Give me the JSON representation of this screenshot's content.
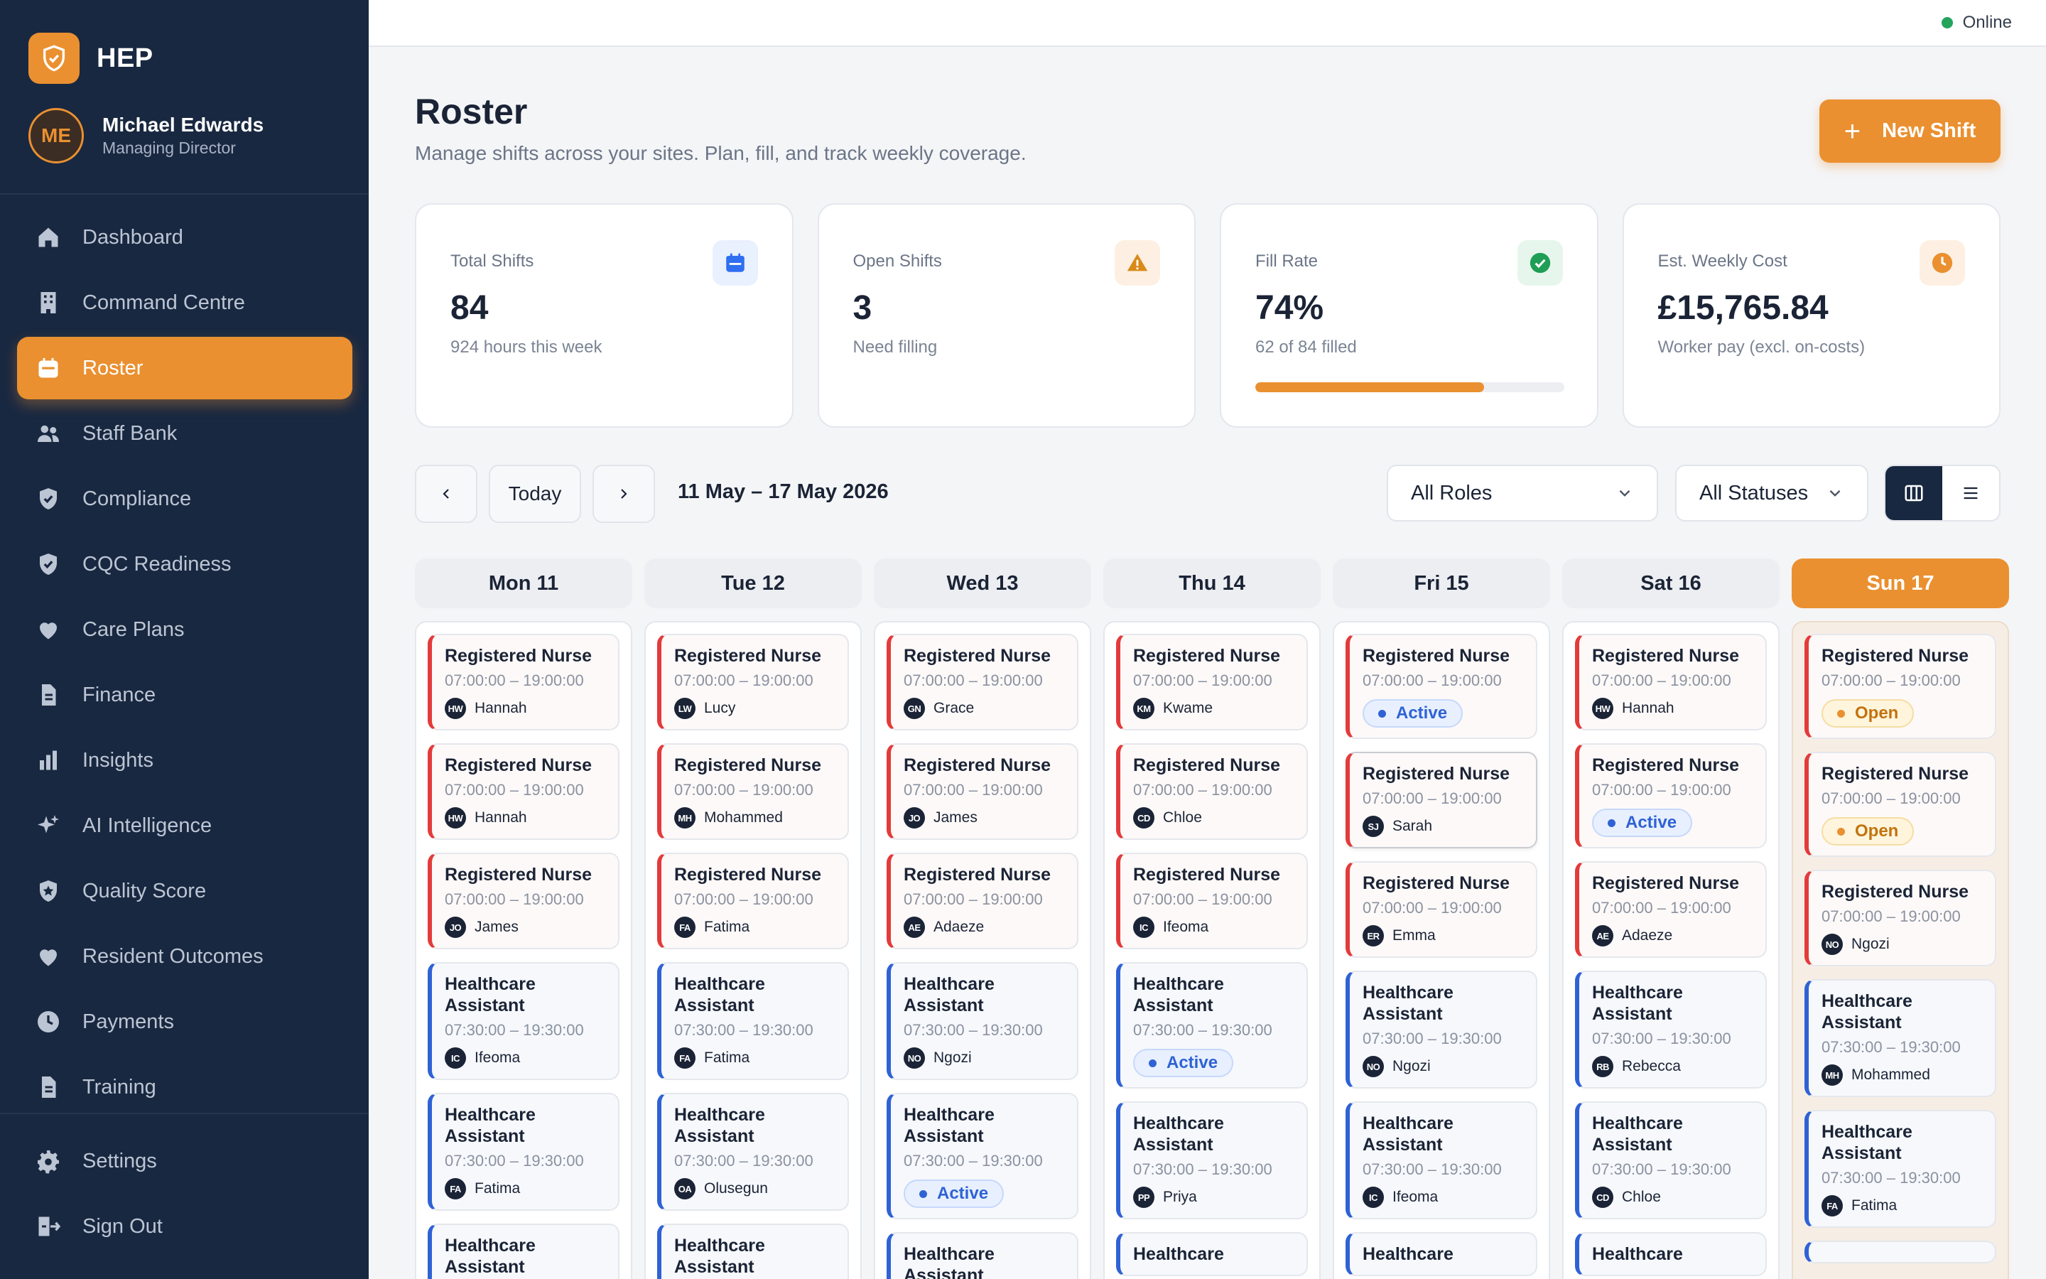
{
  "brand": {
    "name": "HEP"
  },
  "user": {
    "initials": "ME",
    "name": "Michael Edwards",
    "role": "Managing Director"
  },
  "nav": [
    {
      "label": "Dashboard",
      "icon": "home-icon"
    },
    {
      "label": "Command Centre",
      "icon": "building-icon"
    },
    {
      "label": "Roster",
      "icon": "calendar-icon",
      "active": true
    },
    {
      "label": "Staff Bank",
      "icon": "users-icon"
    },
    {
      "label": "Compliance",
      "icon": "shield-check-icon"
    },
    {
      "label": "CQC Readiness",
      "icon": "shield-check-icon"
    },
    {
      "label": "Care Plans",
      "icon": "heart-icon"
    },
    {
      "label": "Finance",
      "icon": "document-icon"
    },
    {
      "label": "Insights",
      "icon": "bar-chart-icon"
    },
    {
      "label": "AI Intelligence",
      "icon": "sparkles-icon"
    },
    {
      "label": "Quality Score",
      "icon": "shield-star-icon"
    },
    {
      "label": "Resident Outcomes",
      "icon": "heart-icon"
    },
    {
      "label": "Payments",
      "icon": "clock-icon"
    },
    {
      "label": "Training",
      "icon": "document-icon"
    }
  ],
  "nav_bottom": [
    {
      "label": "Settings",
      "icon": "gear-icon"
    },
    {
      "label": "Sign Out",
      "icon": "logout-icon"
    }
  ],
  "status": {
    "label": "Online",
    "color": "#22a45d"
  },
  "header": {
    "title": "Roster",
    "subtitle": "Manage shifts across your sites. Plan, fill, and track weekly coverage.",
    "new_shift_label": "New Shift"
  },
  "stats": [
    {
      "label": "Total Shifts",
      "value": "84",
      "sub": "924 hours this week",
      "icon": "calendar-icon"
    },
    {
      "label": "Open Shifts",
      "value": "3",
      "sub": "Need filling",
      "icon": "warning-icon"
    },
    {
      "label": "Fill Rate",
      "value": "74%",
      "sub": "62 of 84 filled",
      "icon": "check-circle-icon",
      "progress": 0.74
    },
    {
      "label": "Est. Weekly Cost",
      "value": "£15,765.84",
      "sub": "Worker pay (excl. on-costs)",
      "icon": "clock-icon"
    }
  ],
  "toolbar": {
    "today_label": "Today",
    "date_range": "11 May – 17 May 2026",
    "role_filter": "All Roles",
    "status_filter": "All Statuses"
  },
  "colors": {
    "accent": "#ea9030",
    "navy": "#192841",
    "registered_nurse": "#e33b3b",
    "healthcare_assistant": "#2f62d4"
  },
  "days": [
    {
      "label": "Mon 11",
      "today": false,
      "shifts": [
        {
          "type": "rn",
          "role": "Registered Nurse",
          "time": "07:00:00 – 19:00:00",
          "initials": "HW",
          "worker": "Hannah"
        },
        {
          "type": "rn",
          "role": "Registered Nurse",
          "time": "07:00:00 – 19:00:00",
          "initials": "HW",
          "worker": "Hannah"
        },
        {
          "type": "rn",
          "role": "Registered Nurse",
          "time": "07:00:00 – 19:00:00",
          "initials": "JO",
          "worker": "James"
        },
        {
          "type": "ha",
          "role": "Healthcare Assistant",
          "time": "07:30:00 – 19:30:00",
          "initials": "IC",
          "worker": "Ifeoma"
        },
        {
          "type": "ha",
          "role": "Healthcare Assistant",
          "time": "07:30:00 – 19:30:00",
          "initials": "FA",
          "worker": "Fatima"
        },
        {
          "type": "ha",
          "role": "Healthcare Assistant",
          "time": "",
          "initials": "",
          "worker": ""
        }
      ]
    },
    {
      "label": "Tue 12",
      "today": false,
      "shifts": [
        {
          "type": "rn",
          "role": "Registered Nurse",
          "time": "07:00:00 – 19:00:00",
          "initials": "LW",
          "worker": "Lucy"
        },
        {
          "type": "rn",
          "role": "Registered Nurse",
          "time": "07:00:00 – 19:00:00",
          "initials": "MH",
          "worker": "Mohammed"
        },
        {
          "type": "rn",
          "role": "Registered Nurse",
          "time": "07:00:00 – 19:00:00",
          "initials": "FA",
          "worker": "Fatima"
        },
        {
          "type": "ha",
          "role": "Healthcare Assistant",
          "time": "07:30:00 – 19:30:00",
          "initials": "FA",
          "worker": "Fatima"
        },
        {
          "type": "ha",
          "role": "Healthcare Assistant",
          "time": "07:30:00 – 19:30:00",
          "initials": "OA",
          "worker": "Olusegun"
        },
        {
          "type": "ha",
          "role": "Healthcare Assistant",
          "time": "",
          "initials": "",
          "worker": ""
        }
      ]
    },
    {
      "label": "Wed 13",
      "today": false,
      "shifts": [
        {
          "type": "rn",
          "role": "Registered Nurse",
          "time": "07:00:00 – 19:00:00",
          "initials": "GN",
          "worker": "Grace"
        },
        {
          "type": "rn",
          "role": "Registered Nurse",
          "time": "07:00:00 – 19:00:00",
          "initials": "JO",
          "worker": "James"
        },
        {
          "type": "rn",
          "role": "Registered Nurse",
          "time": "07:00:00 – 19:00:00",
          "initials": "AE",
          "worker": "Adaeze"
        },
        {
          "type": "ha",
          "role": "Healthcare Assistant",
          "time": "07:30:00 – 19:30:00",
          "initials": "NO",
          "worker": "Ngozi"
        },
        {
          "type": "ha",
          "role": "Healthcare Assistant",
          "time": "07:30:00 – 19:30:00",
          "badge": "active",
          "badge_label": "Active"
        },
        {
          "type": "ha",
          "role": "Healthcare Assistant",
          "time": "",
          "initials": "",
          "worker": ""
        }
      ]
    },
    {
      "label": "Thu 14",
      "today": false,
      "shifts": [
        {
          "type": "rn",
          "role": "Registered Nurse",
          "time": "07:00:00 – 19:00:00",
          "initials": "KM",
          "worker": "Kwame"
        },
        {
          "type": "rn",
          "role": "Registered Nurse",
          "time": "07:00:00 – 19:00:00",
          "initials": "CD",
          "worker": "Chloe"
        },
        {
          "type": "rn",
          "role": "Registered Nurse",
          "time": "07:00:00 – 19:00:00",
          "initials": "IC",
          "worker": "Ifeoma"
        },
        {
          "type": "ha",
          "role": "Healthcare Assistant",
          "time": "07:30:00 – 19:30:00",
          "badge": "active",
          "badge_label": "Active"
        },
        {
          "type": "ha",
          "role": "Healthcare Assistant",
          "time": "07:30:00 – 19:30:00",
          "initials": "PP",
          "worker": "Priya"
        },
        {
          "type": "ha",
          "role": "Healthcare",
          "time": "",
          "initials": "",
          "worker": ""
        }
      ]
    },
    {
      "label": "Fri 15",
      "today": false,
      "shifts": [
        {
          "type": "rn",
          "role": "Registered Nurse",
          "time": "07:00:00 – 19:00:00",
          "badge": "active",
          "badge_label": "Active"
        },
        {
          "type": "rn",
          "sel": true,
          "role": "Registered Nurse",
          "time": "07:00:00 – 19:00:00",
          "initials": "SJ",
          "worker": "Sarah"
        },
        {
          "type": "rn",
          "role": "Registered Nurse",
          "time": "07:00:00 – 19:00:00",
          "initials": "ER",
          "worker": "Emma"
        },
        {
          "type": "ha",
          "role": "Healthcare Assistant",
          "time": "07:30:00 – 19:30:00",
          "initials": "NO",
          "worker": "Ngozi"
        },
        {
          "type": "ha",
          "role": "Healthcare Assistant",
          "time": "07:30:00 – 19:30:00",
          "initials": "IC",
          "worker": "Ifeoma"
        },
        {
          "type": "ha",
          "role": "Healthcare",
          "time": "",
          "initials": "",
          "worker": ""
        }
      ]
    },
    {
      "label": "Sat 16",
      "today": false,
      "shifts": [
        {
          "type": "rn",
          "role": "Registered Nurse",
          "time": "07:00:00 – 19:00:00",
          "initials": "HW",
          "worker": "Hannah"
        },
        {
          "type": "rn",
          "role": "Registered Nurse",
          "time": "07:00:00 – 19:00:00",
          "badge": "active",
          "badge_label": "Active"
        },
        {
          "type": "rn",
          "role": "Registered Nurse",
          "time": "07:00:00 – 19:00:00",
          "initials": "AE",
          "worker": "Adaeze"
        },
        {
          "type": "ha",
          "role": "Healthcare Assistant",
          "time": "07:30:00 – 19:30:00",
          "initials": "RB",
          "worker": "Rebecca"
        },
        {
          "type": "ha",
          "role": "Healthcare Assistant",
          "time": "07:30:00 – 19:30:00",
          "initials": "CD",
          "worker": "Chloe"
        },
        {
          "type": "ha",
          "role": "Healthcare",
          "time": "",
          "initials": "",
          "worker": ""
        }
      ]
    },
    {
      "label": "Sun 17",
      "today": true,
      "shifts": [
        {
          "type": "rn",
          "role": "Registered Nurse",
          "time": "07:00:00 – 19:00:00",
          "badge": "open",
          "badge_label": "Open"
        },
        {
          "type": "rn",
          "role": "Registered Nurse",
          "time": "07:00:00 – 19:00:00",
          "badge": "open",
          "badge_label": "Open"
        },
        {
          "type": "rn",
          "role": "Registered Nurse",
          "time": "07:00:00 – 19:00:00",
          "initials": "NO",
          "worker": "Ngozi"
        },
        {
          "type": "ha",
          "role": "Healthcare Assistant",
          "time": "07:30:00 – 19:30:00",
          "initials": "MH",
          "worker": "Mohammed"
        },
        {
          "type": "ha",
          "role": "Healthcare Assistant",
          "time": "07:30:00 – 19:30:00",
          "initials": "FA",
          "worker": "Fatima"
        },
        {
          "type": "ha",
          "role": "",
          "time": "",
          "initials": "",
          "worker": ""
        }
      ]
    }
  ]
}
